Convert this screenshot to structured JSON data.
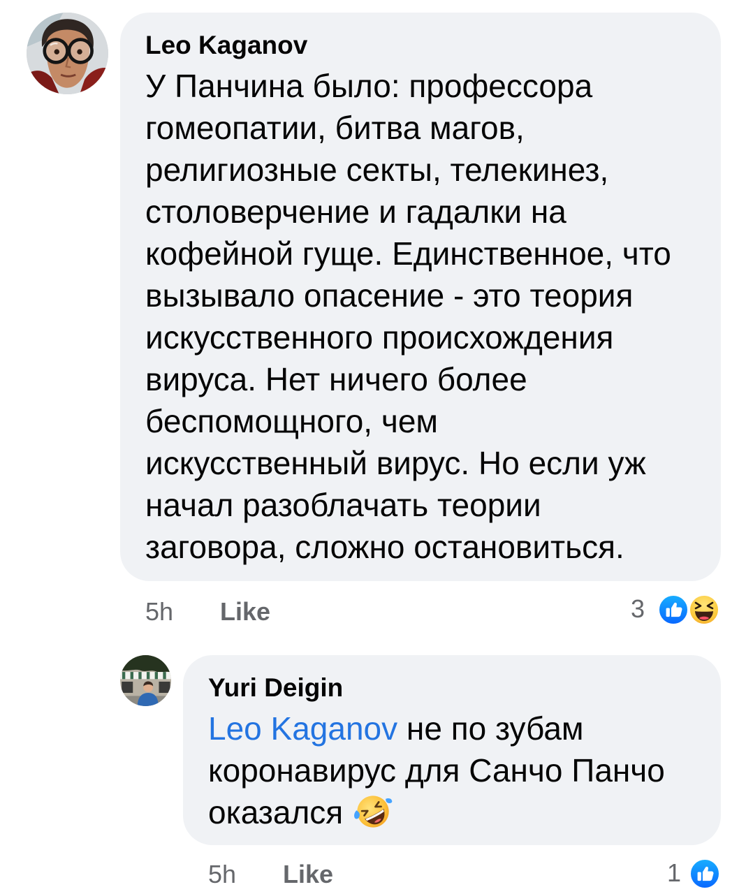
{
  "colors": {
    "bubble_bg": "#f0f2f5",
    "text": "#050505",
    "muted": "#65676b",
    "link": "#2374e1",
    "like_blue": "#0866ff"
  },
  "comments": [
    {
      "author": "Leo Kaganov",
      "body_lines": [
        "У Панчина было: профессора",
        "гомеопатии, битва магов,",
        "религиозные секты, телекинез,",
        "столоверчение и гадалки на",
        "кофейной гуще. Единственное, что",
        "вызывало опасение - это теория",
        "искусственного происхождения",
        "вируса. Нет ничего более",
        "беспомощного, чем",
        "искусственный вирус. Но если уж",
        "начал разоблачать теории",
        "заговора, сложно остановиться."
      ],
      "time": "5h",
      "like_label": "Like",
      "reaction_count": "3",
      "reactions": [
        "like-icon",
        "haha-icon"
      ]
    },
    {
      "author": "Yuri Deigin",
      "mention": "Leo Kaganov",
      "body_lines": [
        " не по зубам",
        "коронавирус для Санчо Панчо",
        "оказался"
      ],
      "body_emoji": "rolling-on-floor-laughing-icon",
      "time": "5h",
      "like_label": "Like",
      "reaction_count": "1",
      "reactions": [
        "like-icon"
      ]
    }
  ]
}
